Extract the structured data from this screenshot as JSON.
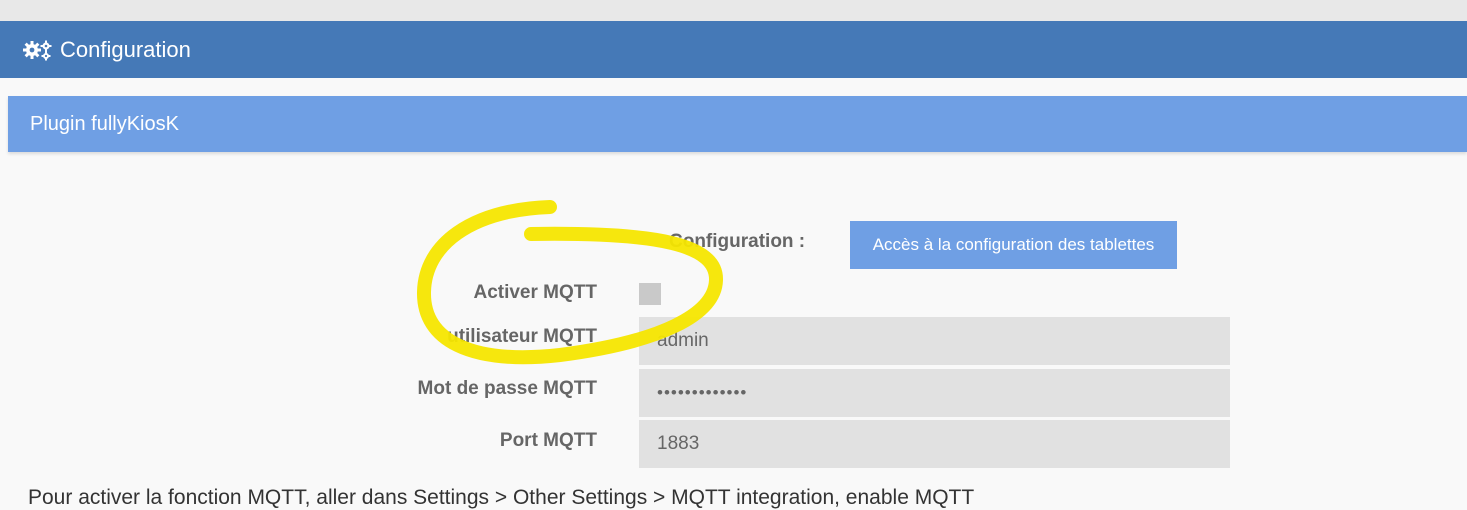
{
  "header": {
    "title": "Configuration",
    "icon": "gears-icon",
    "color": "#4579b7"
  },
  "plugin_panel": {
    "title": "Plugin fullyKiosK",
    "color": "#6f9fe4"
  },
  "form": {
    "configuration_label": "Configuration :",
    "tablettes_button_label": "Accès à la configuration des tablettes",
    "activer_mqtt_label": "Activer MQTT",
    "activer_mqtt_checked": false,
    "utilisateur_label": "utilisateur MQTT",
    "utilisateur_value": "admin",
    "password_label": "Mot de passe MQTT",
    "password_value": "•••••••••••••",
    "port_label": "Port MQTT",
    "port_value": "1883"
  },
  "annotation": {
    "color": "#f5e600"
  },
  "footer_text": "Pour activer la fonction MQTT, aller dans Settings > Other Settings > MQTT integration, enable MQTT"
}
